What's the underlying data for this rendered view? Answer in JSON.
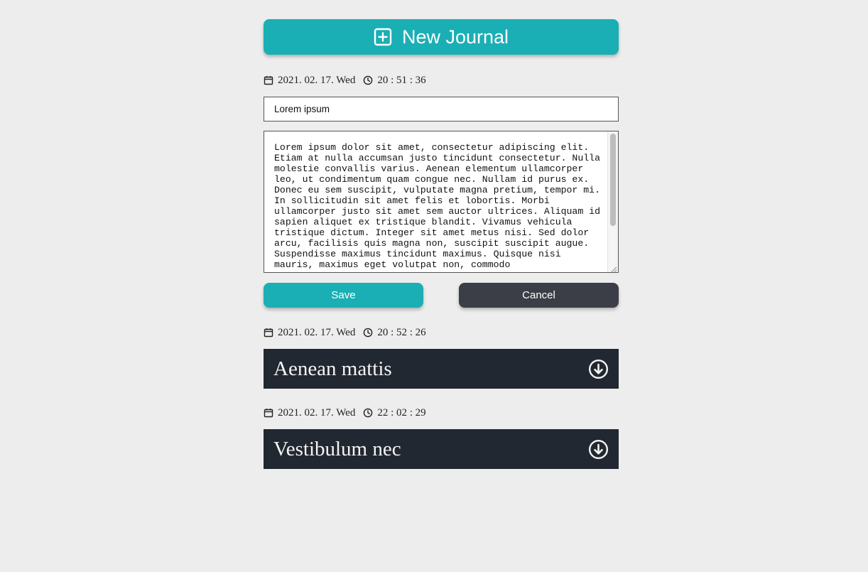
{
  "header": {
    "new_journal_label": "New Journal",
    "accent_color": "#1aafb5"
  },
  "editor": {
    "date": "2021. 02. 17. Wed",
    "time": "20 : 51 : 36",
    "title_value": "Lorem ipsum",
    "body_value": "Lorem ipsum dolor sit amet, consectetur adipiscing elit. Etiam at nulla accumsan justo tincidunt consectetur. Nulla molestie convallis varius. Aenean elementum ullamcorper leo, ut condimentum quam congue nec. Nullam id purus ex. Donec eu sem suscipit, vulputate magna pretium, tempor mi. In sollicitudin sit amet felis et lobortis. Morbi ullamcorper justo sit amet sem auctor ultrices. Aliquam id sapien aliquet ex tristique blandit. Vivamus vehicula tristique dictum. Integer sit amet metus nisi. Sed dolor arcu, facilisis quis magna non, suscipit suscipit augue. Suspendisse maximus tincidunt maximus. Quisque nisi mauris, maximus eget volutpat non, commodo",
    "save_label": "Save",
    "cancel_label": "Cancel",
    "cancel_color": "#3b3e46"
  },
  "entries": [
    {
      "date": "2021. 02. 17. Wed",
      "time": "20 : 52 : 26",
      "title": "Aenean mattis",
      "icon": "arrow-circle-down-icon"
    },
    {
      "date": "2021. 02. 17. Wed",
      "time": "22 : 02 : 29",
      "title": "Vestibulum nec",
      "icon": "arrow-circle-down-icon"
    }
  ],
  "entry_bar_color": "#222831"
}
